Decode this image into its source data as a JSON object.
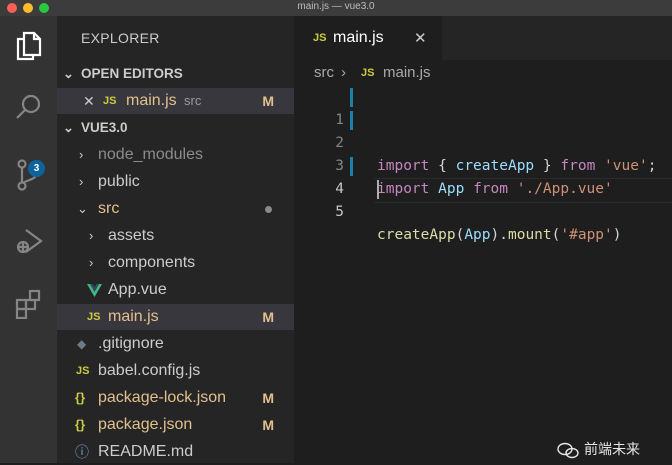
{
  "window": {
    "title": "main.js — vue3.0"
  },
  "traffic_lights": {
    "close_color": "#fe5f57",
    "minimize_color": "#febc2e",
    "maximize_color": "#28c840"
  },
  "activity_bar": {
    "items": [
      "files-icon",
      "search-icon",
      "source-control-icon",
      "run-debug-icon",
      "extensions-icon"
    ],
    "scm_badge": "3"
  },
  "sidebar": {
    "title": "EXPLORER",
    "open_editors": {
      "header": "OPEN EDITORS",
      "items": [
        {
          "icon": "JS",
          "name": "main.js",
          "path": "src",
          "status": "M"
        }
      ]
    },
    "project": {
      "header": "VUE3.0",
      "tree": [
        {
          "label": "node_modules",
          "type": "folder",
          "state": "collapsed"
        },
        {
          "label": "public",
          "type": "folder",
          "state": "collapsed"
        },
        {
          "label": "src",
          "type": "folder",
          "state": "expanded"
        },
        {
          "label": "assets",
          "type": "folder",
          "state": "collapsed"
        },
        {
          "label": "components",
          "type": "folder",
          "state": "collapsed"
        },
        {
          "label": "App.vue",
          "type": "vue"
        },
        {
          "label": "main.js",
          "type": "js",
          "status": "M"
        },
        {
          "label": ".gitignore",
          "type": "git"
        },
        {
          "label": "babel.config.js",
          "type": "js"
        },
        {
          "label": "package-lock.json",
          "type": "json",
          "status": "M"
        },
        {
          "label": "package.json",
          "type": "json",
          "status": "M"
        },
        {
          "label": "README.md",
          "type": "info"
        }
      ]
    }
  },
  "tabs": [
    {
      "icon": "JS",
      "label": "main.js"
    }
  ],
  "breadcrumb": {
    "folder": "src",
    "separator": "›",
    "icon": "JS",
    "file": "main.js"
  },
  "editor": {
    "line_numbers": [
      "1",
      "2",
      "3",
      "4",
      "5"
    ],
    "lines": [
      [
        "import",
        " { ",
        "createApp",
        " } ",
        "from",
        " ",
        "'vue'",
        ";"
      ],
      [
        "import",
        " ",
        "App",
        " ",
        "from",
        " ",
        "'./App.vue'"
      ],
      [],
      [
        "createApp",
        "(",
        "App",
        ").",
        "mount",
        "(",
        "'#app'",
        ")"
      ],
      []
    ]
  },
  "watermark": {
    "text": "前端未来"
  },
  "colors": {
    "accent": "#1b81a8",
    "modified": "#e2c08d",
    "js_icon": "#cbcb41",
    "vue_icon": "#41b883"
  }
}
